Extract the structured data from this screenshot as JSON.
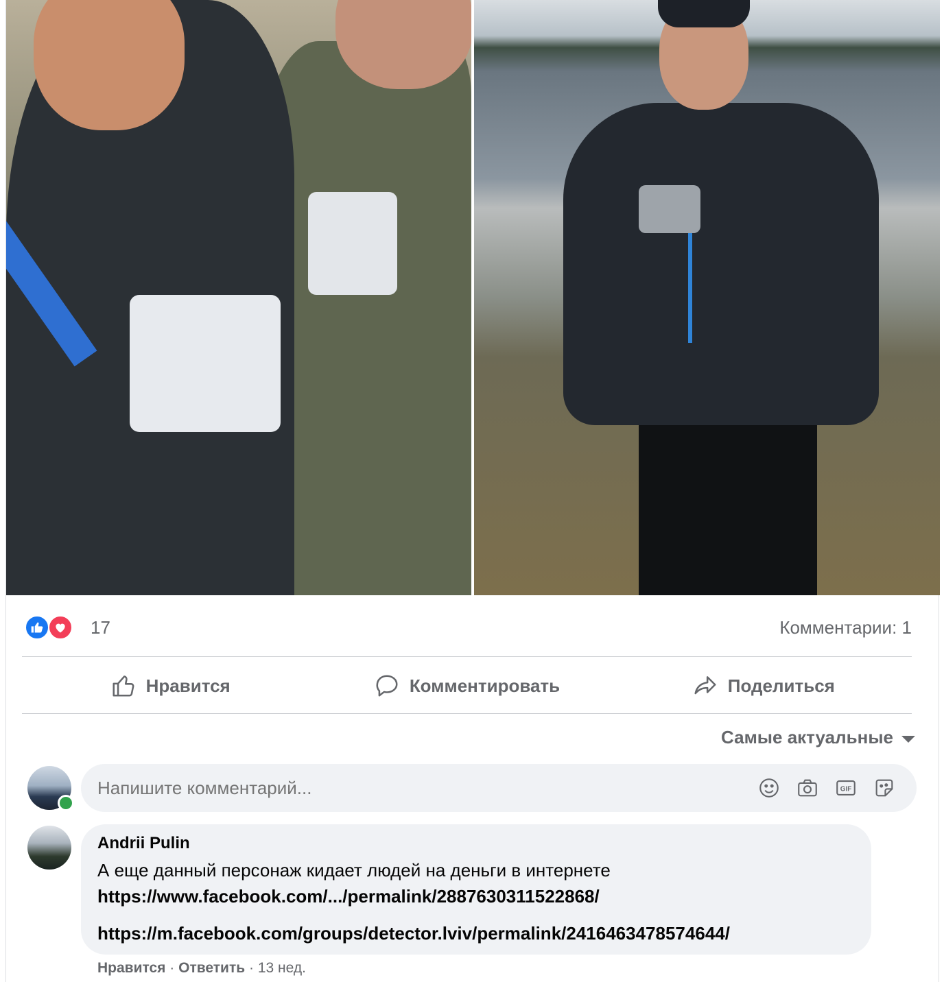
{
  "post": {
    "reactions": {
      "count": "17",
      "icons": [
        "like-icon",
        "love-icon"
      ]
    },
    "comments_count": "Комментарии: 1"
  },
  "actions": {
    "like": "Нравится",
    "comment": "Комментировать",
    "share": "Поделиться"
  },
  "sort": {
    "label": "Самые актуальные"
  },
  "composer": {
    "placeholder": "Напишите комментарий...",
    "icons": [
      "emoji-icon",
      "camera-icon",
      "gif-icon",
      "sticker-icon"
    ]
  },
  "comments": [
    {
      "author": "Andrii Pulin",
      "text": "А еще данный персонаж кидает людей на деньги в интернете",
      "link1": "https://www.facebook.com/.../permalink/2887630311522868/",
      "link2": "https://m.facebook.com/groups/detector.lviv/permalink/2416463478574644/",
      "like": "Нравится",
      "reply": "Ответить",
      "time": "13 нед."
    }
  ],
  "colors": {
    "like_blue": "#1877f2",
    "love_red": "#f33e58",
    "secondary_text": "#65676b",
    "bubble_bg": "#f0f2f5"
  }
}
